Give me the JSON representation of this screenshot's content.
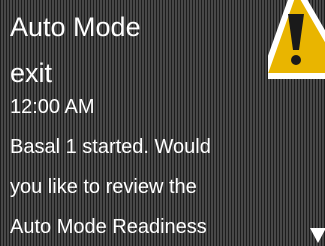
{
  "alert": {
    "title": "Auto Mode",
    "subtitle": "exit",
    "time": "12:00 AM",
    "message_lines": [
      "Basal 1 started. Would",
      "you like to review the",
      "Auto Mode Readiness"
    ],
    "icon": "warning-triangle-icon",
    "scroll_indicator": "scroll-down-arrow-icon"
  },
  "colors": {
    "background": "#3d3d3d",
    "text": "#ffffff",
    "warning_fill": "#e9b500",
    "warning_outline": "#ffffff",
    "warning_mark": "#1a1a1a"
  }
}
